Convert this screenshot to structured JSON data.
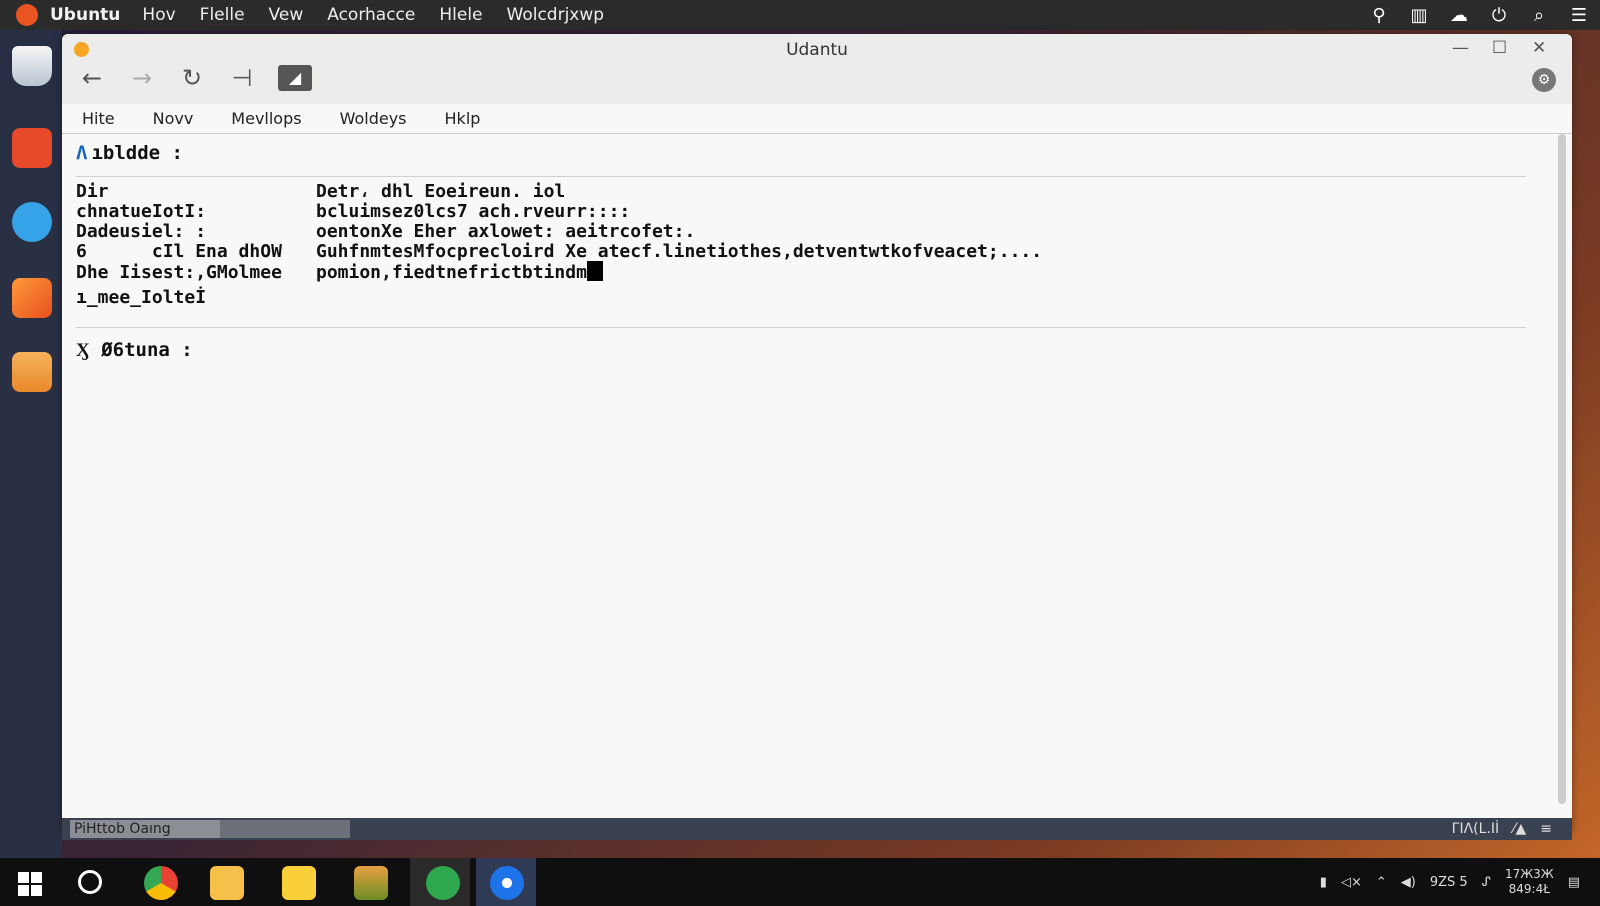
{
  "topbar": {
    "app_name": "Ubuntu",
    "menu": [
      "Hov",
      "Flelle",
      "Vew",
      "Acorhacce",
      "Hlele",
      "Wolcdrjxwp"
    ]
  },
  "window": {
    "title": "Udantu",
    "menubar": [
      "Hite",
      "Novv",
      "Mevllops",
      "Woldeys",
      "Hklp"
    ]
  },
  "content": {
    "section1": {
      "mark": "Λ",
      "label": "ıbldde :"
    },
    "rows": [
      {
        "k": "Dir",
        "v": "Detr، dhl Eoeireun. iol"
      },
      {
        "k": "chnatueIotI:",
        "v": "bcluimsez0lcs7 ach.rveurr::::"
      },
      {
        "k": "Dadeusiel: :",
        "v": "oentonXe Eher axlowet: aeitrcofet:."
      },
      {
        "k": "6      cIl Ena dhOW",
        "v": "GuhfnmtesMfocprecloird Xe atecf.linetiothes,detventwtkofveacet;...."
      },
      {
        "k": "Dhe Iisest:,GMolmee",
        "v": "pomion,fiedtnefrictbtindm"
      }
    ],
    "footer_line": "ı_mee_Iolteİ",
    "section2": {
      "mark": "Ӽ",
      "label": "Ø6tuna :"
    }
  },
  "statusbar": {
    "left_label": "PiHttob Oaıng",
    "right": [
      "ΓΙΛ(L.Iİ",
      "⁄▲",
      "≡"
    ]
  },
  "taskbar": {
    "clock_time": "17Ж3Ж",
    "clock_date": "849:4Ł",
    "tray_text": "9ZS 5"
  }
}
